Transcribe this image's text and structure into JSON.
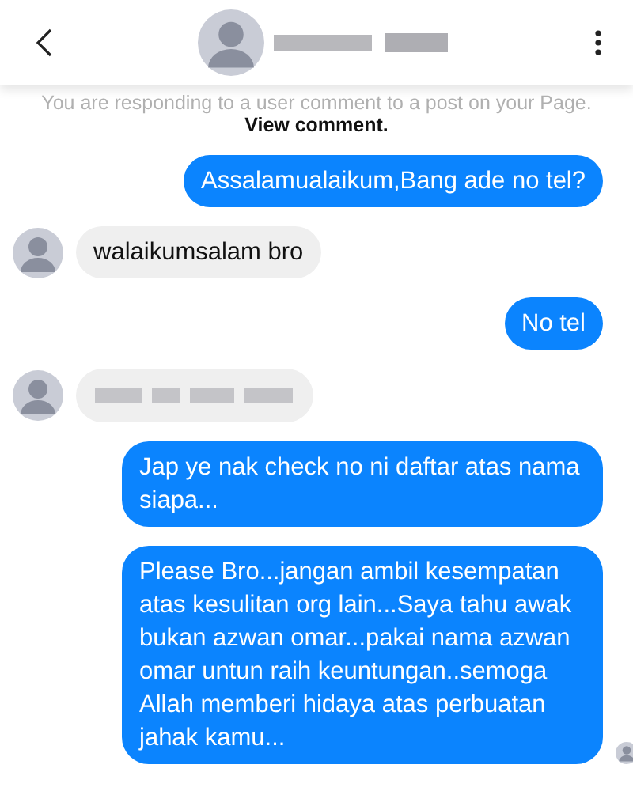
{
  "notice": {
    "text": "You are responding to a user comment to a post on your Page.",
    "link": "View comment."
  },
  "messages": [
    {
      "kind": "outgoing",
      "text": "Assalamualaikum,Bang ade no tel?"
    },
    {
      "kind": "incoming",
      "text": "walaikumsalam bro"
    },
    {
      "kind": "outgoing",
      "text": "No tel"
    },
    {
      "kind": "incoming",
      "redacted": true
    },
    {
      "kind": "outgoing",
      "text": "Jap ye nak check no ni daftar atas nama siapa..."
    },
    {
      "kind": "outgoing",
      "text": "Please Bro...jangan ambil kesempatan atas kesulitan org lain...Saya tahu awak bukan azwan omar...pakai nama azwan omar untun raih keuntungan..semoga Allah memberi hidaya atas perbuatan jahak kamu...",
      "seen": true
    }
  ]
}
